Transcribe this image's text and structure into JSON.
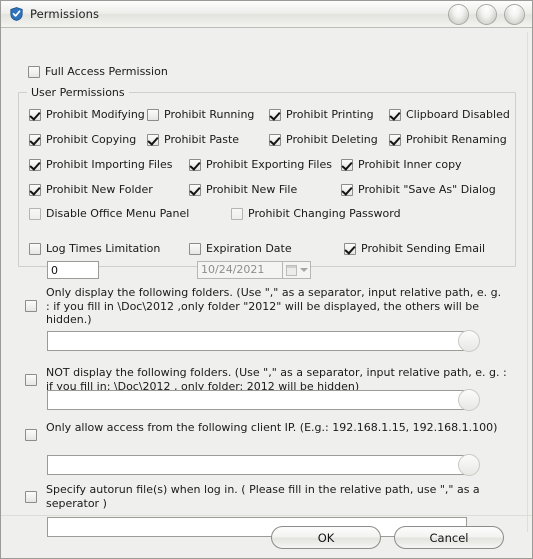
{
  "window": {
    "title": "Permissions",
    "icon": "shield-check-icon",
    "controls": [
      {
        "name": "minimize-button",
        "label": ""
      },
      {
        "name": "maximize-button",
        "label": ""
      },
      {
        "name": "close-button",
        "label": ""
      }
    ]
  },
  "full_access": {
    "label": "Full Access Permission",
    "checked": false
  },
  "user_permissions": {
    "group_title": "User Permissions",
    "items": [
      {
        "label": "Prohibit Modifying",
        "checked": true,
        "col": 0,
        "row": 0
      },
      {
        "label": "Prohibit Running",
        "checked": false,
        "col": 1,
        "row": 0
      },
      {
        "label": "Prohibit Printing",
        "checked": true,
        "col": 2,
        "row": 0
      },
      {
        "label": "Clipboard Disabled",
        "checked": true,
        "col": 3,
        "row": 0
      },
      {
        "label": "Prohibit Copying",
        "checked": true,
        "col": 0,
        "row": 1
      },
      {
        "label": "Prohibit Paste",
        "checked": true,
        "col": 1,
        "row": 1
      },
      {
        "label": "Prohibit Deleting",
        "checked": true,
        "col": 2,
        "row": 1
      },
      {
        "label": "Prohibit Renaming",
        "checked": true,
        "col": 3,
        "row": 1
      },
      {
        "label": "Prohibit Importing Files",
        "checked": true,
        "col": 0,
        "row": 2
      },
      {
        "label": "Prohibit Exporting Files",
        "checked": true,
        "col": 1,
        "row": 2
      },
      {
        "label": "Prohibit Inner copy",
        "checked": true,
        "col": 2,
        "row": 2
      },
      {
        "label": "Prohibit New Folder",
        "checked": true,
        "col": 0,
        "row": 3
      },
      {
        "label": "Prohibit New File",
        "checked": true,
        "col": 1,
        "row": 3
      },
      {
        "label": "Prohibit \"Save As\" Dialog",
        "checked": true,
        "col": 2,
        "row": 3
      }
    ],
    "disable_office_menu": {
      "label": "Disable Office Menu Panel",
      "checked": false
    },
    "prohibit_changing_password": {
      "label": "Prohibit Changing Password",
      "checked": false
    }
  },
  "limits": {
    "log_times": {
      "label": "Log Times Limitation",
      "checked": false,
      "value": "0"
    },
    "expiration": {
      "label": "Expiration Date",
      "checked": false,
      "value": "10/24/2021",
      "enabled": false
    },
    "prohibit_sending_email": {
      "label": "Prohibit Sending Email",
      "checked": true
    }
  },
  "blocks": [
    {
      "name": "only-display-folders",
      "checked": false,
      "description": "Only display the following folders. (Use \",\" as a separator, input relative path,  e. g. : if you fill in \\Doc\\2012 ,only folder \"2012\" will be displayed, the others will be hidden.)",
      "value": "",
      "has_browse_button": true
    },
    {
      "name": "not-display-folders",
      "checked": false,
      "description": "NOT display the following folders. (Use \",\" as a separator, input relative path,  e. g. : if you fill in: \\Doc\\2012 , only folder: 2012 will be hidden)",
      "value": "",
      "has_browse_button": true
    },
    {
      "name": "allow-client-ip",
      "checked": false,
      "description": "Only allow access from the following client IP. (E.g.: 192.168.1.15, 192.168.1.100)",
      "value": "",
      "has_browse_button": true
    },
    {
      "name": "autorun-files",
      "checked": false,
      "description": "Specify autorun file(s) when log in. ( Please fill in the relative path, use \",\" as a seperator )",
      "value": "",
      "has_browse_button": false
    }
  ],
  "footer": {
    "ok_label": "OK",
    "cancel_label": "Cancel"
  }
}
